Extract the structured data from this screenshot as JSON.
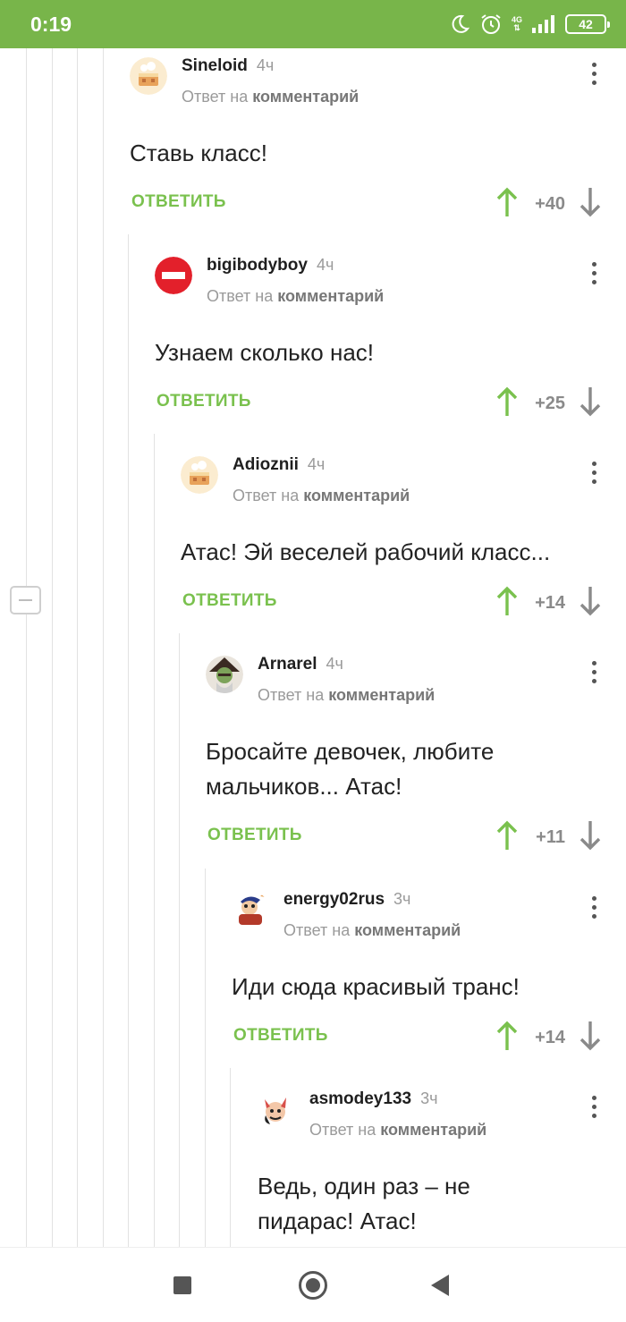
{
  "status_bar": {
    "time": "0:19",
    "network": "4G",
    "battery": "42"
  },
  "reply_label": "ОТВЕТИТЬ",
  "reply_prefix": "Ответ на",
  "reply_target": "комментарий",
  "comments": [
    {
      "author": "Sineloid",
      "time": "4ч",
      "avatar": "cake-avatar",
      "text": "Ставь класс!",
      "score": "+40"
    },
    {
      "author": "bigibodyboy",
      "time": "4ч",
      "avatar": "no-entry-avatar",
      "text": "Узнаем сколько нас!",
      "score": "+25"
    },
    {
      "author": "Adioznii",
      "time": "4ч",
      "avatar": "cake-avatar",
      "text": "Атас! Эй веселей рабочий класс...",
      "score": "+14"
    },
    {
      "author": "Arnarel",
      "time": "4ч",
      "avatar": "wizard-avatar",
      "text": "Бросайте девочек, любите мальчиков... Атас!",
      "score": "+11"
    },
    {
      "author": "energy02rus",
      "time": "3ч",
      "avatar": "cartoon-avatar",
      "text": "Иди сюда красивый транс!",
      "score": "+14"
    },
    {
      "author": "asmodey133",
      "time": "3ч",
      "avatar": "devil-avatar",
      "text": "Ведь, один раз – не пидарас! Атас!",
      "score": ""
    }
  ],
  "colors": {
    "accent": "#78b54a",
    "reply": "#7ac14e",
    "vote_up": "#7ac14e",
    "vote_down": "#8a8a8a"
  }
}
